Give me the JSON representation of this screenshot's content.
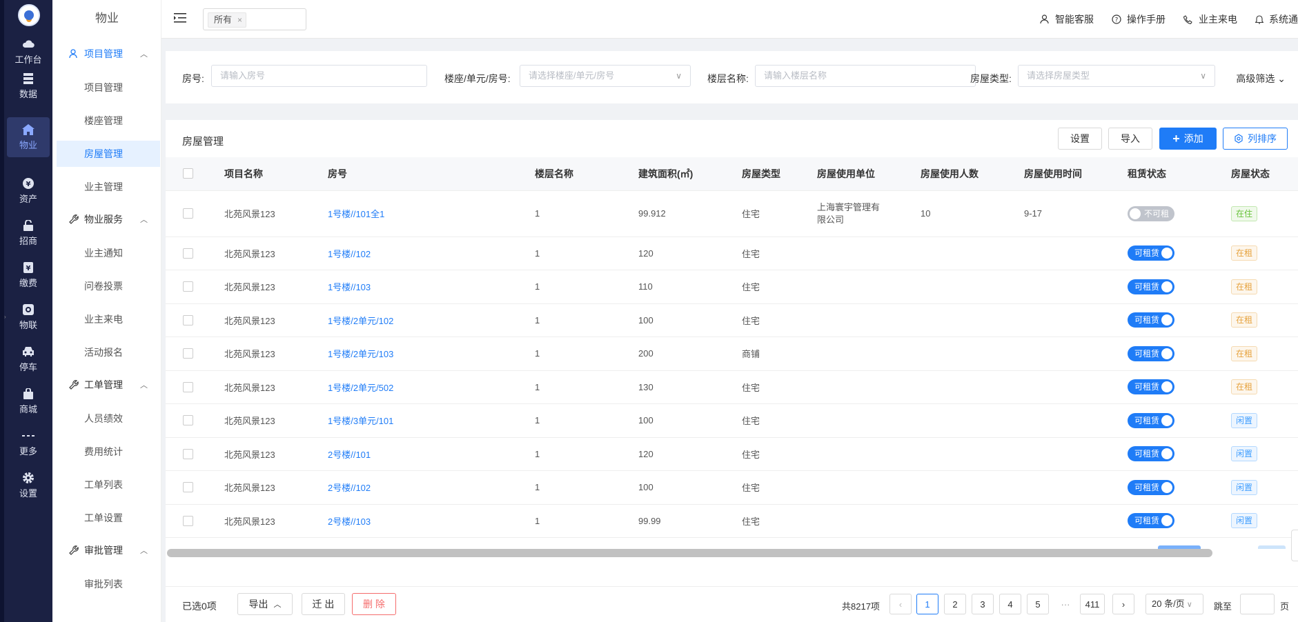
{
  "rail": {
    "items": [
      {
        "label": "工作台",
        "icon": "cloud-icon"
      },
      {
        "label": "数据",
        "icon": "database-icon"
      },
      {
        "label": "物业",
        "icon": "home-icon"
      },
      {
        "label": "资产",
        "icon": "yen-circle-icon"
      },
      {
        "label": "招商",
        "icon": "unlock-icon"
      },
      {
        "label": "缴费",
        "icon": "yen-box-icon"
      },
      {
        "label": "物联",
        "icon": "iot-icon"
      },
      {
        "label": "停车",
        "icon": "car-icon"
      },
      {
        "label": "商城",
        "icon": "shopping-bag-icon"
      },
      {
        "label": "更多",
        "icon": "more-icon"
      },
      {
        "label": "设置",
        "icon": "gear-icon"
      }
    ],
    "active_index": 2
  },
  "sidebar": {
    "title": "物业",
    "groups": [
      {
        "label": "项目管理",
        "icon": "user-icon",
        "items": [
          "项目管理",
          "楼座管理",
          "房屋管理",
          "业主管理"
        ]
      },
      {
        "label": "物业服务",
        "icon": "wrench-icon",
        "items": [
          "业主通知",
          "问卷投票",
          "业主来电",
          "活动报名"
        ]
      },
      {
        "label": "工单管理",
        "icon": "wrench-icon",
        "items": [
          "人员绩效",
          "费用统计",
          "工单列表",
          "工单设置"
        ]
      },
      {
        "label": "审批管理",
        "icon": "wrench-icon",
        "items": [
          "审批列表"
        ]
      }
    ],
    "active_item": "房屋管理"
  },
  "topbar": {
    "tag": "所有",
    "links": [
      {
        "label": "智能客服",
        "icon": "user-icon"
      },
      {
        "label": "操作手册",
        "icon": "question-circle-icon"
      },
      {
        "label": "业主来电",
        "icon": "phone-icon"
      },
      {
        "label": "系统通知",
        "icon": "bell-icon"
      }
    ]
  },
  "filter": {
    "room_label": "房号:",
    "room_placeholder": "请输入房号",
    "building_label": "楼座/单元/房号:",
    "building_placeholder": "请选择楼座/单元/房号",
    "floor_label": "楼层名称:",
    "floor_placeholder": "请输入楼层名称",
    "type_label": "房屋类型:",
    "type_placeholder": "请选择房屋类型",
    "advanced": "高级筛选"
  },
  "main": {
    "title": "房屋管理",
    "buttons": {
      "settings": "设置",
      "import": "导入",
      "add": "添加",
      "sort": "列排序"
    }
  },
  "table": {
    "columns": [
      "项目名称",
      "房号",
      "楼层名称",
      "建筑面积(㎡)",
      "房屋类型",
      "房屋使用单位",
      "房屋使用人数",
      "房屋使用时间",
      "租赁状态",
      "房屋状态"
    ],
    "rows": [
      {
        "project": "北苑风景123",
        "room": "1号楼//101全1",
        "floor": "1",
        "area": "99.912",
        "type": "住宅",
        "unit": "上海寰宇管理有限公司",
        "people": "10",
        "time": "9-17",
        "lease": "不可租赁",
        "lease_on": false,
        "status": "在住",
        "status_color": "green"
      },
      {
        "project": "北苑风景123",
        "room": "1号楼//102",
        "floor": "1",
        "area": "120",
        "type": "住宅",
        "unit": "",
        "people": "",
        "time": "",
        "lease": "可租赁",
        "lease_on": true,
        "status": "在租",
        "status_color": "orange"
      },
      {
        "project": "北苑风景123",
        "room": "1号楼//103",
        "floor": "1",
        "area": "110",
        "type": "住宅",
        "unit": "",
        "people": "",
        "time": "",
        "lease": "可租赁",
        "lease_on": true,
        "status": "在租",
        "status_color": "orange"
      },
      {
        "project": "北苑风景123",
        "room": "1号楼/2单元/102",
        "floor": "1",
        "area": "100",
        "type": "住宅",
        "unit": "",
        "people": "",
        "time": "",
        "lease": "可租赁",
        "lease_on": true,
        "status": "在租",
        "status_color": "orange"
      },
      {
        "project": "北苑风景123",
        "room": "1号楼/2单元/103",
        "floor": "1",
        "area": "200",
        "type": "商铺",
        "unit": "",
        "people": "",
        "time": "",
        "lease": "可租赁",
        "lease_on": true,
        "status": "在租",
        "status_color": "orange"
      },
      {
        "project": "北苑风景123",
        "room": "1号楼/2单元/502",
        "floor": "1",
        "area": "130",
        "type": "住宅",
        "unit": "",
        "people": "",
        "time": "",
        "lease": "可租赁",
        "lease_on": true,
        "status": "在租",
        "status_color": "orange"
      },
      {
        "project": "北苑风景123",
        "room": "1号楼/3单元/101",
        "floor": "1",
        "area": "100",
        "type": "住宅",
        "unit": "",
        "people": "",
        "time": "",
        "lease": "可租赁",
        "lease_on": true,
        "status": "闲置",
        "status_color": "blue"
      },
      {
        "project": "北苑风景123",
        "room": "2号楼//101",
        "floor": "1",
        "area": "120",
        "type": "住宅",
        "unit": "",
        "people": "",
        "time": "",
        "lease": "可租赁",
        "lease_on": true,
        "status": "闲置",
        "status_color": "blue"
      },
      {
        "project": "北苑风景123",
        "room": "2号楼//102",
        "floor": "1",
        "area": "100",
        "type": "住宅",
        "unit": "",
        "people": "",
        "time": "",
        "lease": "可租赁",
        "lease_on": true,
        "status": "闲置",
        "status_color": "blue"
      },
      {
        "project": "北苑风景123",
        "room": "2号楼//103",
        "floor": "1",
        "area": "99.99",
        "type": "住宅",
        "unit": "",
        "people": "",
        "time": "",
        "lease": "可租赁",
        "lease_on": true,
        "status": "闲置",
        "status_color": "blue"
      }
    ]
  },
  "footer": {
    "selected": "已选0项",
    "export": "导出",
    "move_out": "迁 出",
    "delete": "删 除",
    "total": "共8217项",
    "pages": [
      "1",
      "2",
      "3",
      "4",
      "5",
      "···",
      "411"
    ],
    "current_page": "1",
    "page_size": "20 条/页",
    "jump_label": "跳至",
    "page_unit": "页"
  },
  "colors": {
    "primary": "#1f7cf7",
    "rail": "#1b2143",
    "danger": "#f56c6c"
  }
}
